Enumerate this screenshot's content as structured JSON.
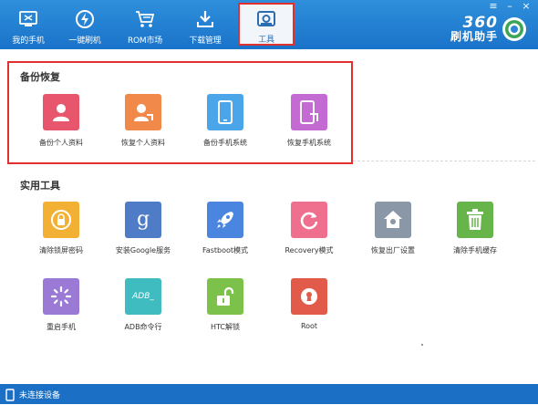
{
  "nav": {
    "items": [
      {
        "label": "我的手机",
        "icon": "phone-screen-icon"
      },
      {
        "label": "一键刷机",
        "icon": "flash-icon"
      },
      {
        "label": "ROM市场",
        "icon": "cart-icon"
      },
      {
        "label": "下载管理",
        "icon": "download-icon"
      },
      {
        "label": "工具",
        "icon": "toolbox-icon",
        "active": true
      }
    ]
  },
  "window": {
    "menu": "≡",
    "minimize": "–",
    "close": "×"
  },
  "brand": {
    "number": "360",
    "name": "刷机助手"
  },
  "backup_section": {
    "title": "备份恢复",
    "items": [
      {
        "label": "备份个人资料",
        "color": "#e8566e",
        "icon": "person-icon"
      },
      {
        "label": "恢复个人资料",
        "color": "#f0894a",
        "icon": "person-restore-icon"
      },
      {
        "label": "备份手机系统",
        "color": "#4aa6e8",
        "icon": "phone-icon"
      },
      {
        "label": "恢复手机系统",
        "color": "#c46ad3",
        "icon": "phone-restore-icon"
      }
    ]
  },
  "tools_section": {
    "title": "实用工具",
    "items": [
      {
        "label": "清除锁屏密码",
        "color": "#f2b134",
        "icon": "unlock-screen-icon"
      },
      {
        "label": "安装Google服务",
        "color": "#4f7cc7",
        "icon": "google-icon",
        "glyph": "g"
      },
      {
        "label": "Fastboot模式",
        "color": "#4a86e0",
        "icon": "rocket-icon"
      },
      {
        "label": "Recovery模式",
        "color": "#ef6f8f",
        "icon": "refresh-icon"
      },
      {
        "label": "恢复出厂设置",
        "color": "#8a97a6",
        "icon": "home-icon"
      },
      {
        "label": "清除手机缓存",
        "color": "#67b44a",
        "icon": "trash-icon"
      },
      {
        "label": "重启手机",
        "color": "#9b7ad6",
        "icon": "restart-icon"
      },
      {
        "label": "ADB命令行",
        "color": "#3fbcbf",
        "icon": "adb-icon",
        "glyph": "ADB_"
      },
      {
        "label": "HTC解锁",
        "color": "#7cc24a",
        "icon": "padlock-icon"
      },
      {
        "label": "Root",
        "color": "#e15a4a",
        "icon": "root-icon"
      }
    ]
  },
  "status": {
    "text": "未连接设备",
    "icon": "device-icon"
  }
}
